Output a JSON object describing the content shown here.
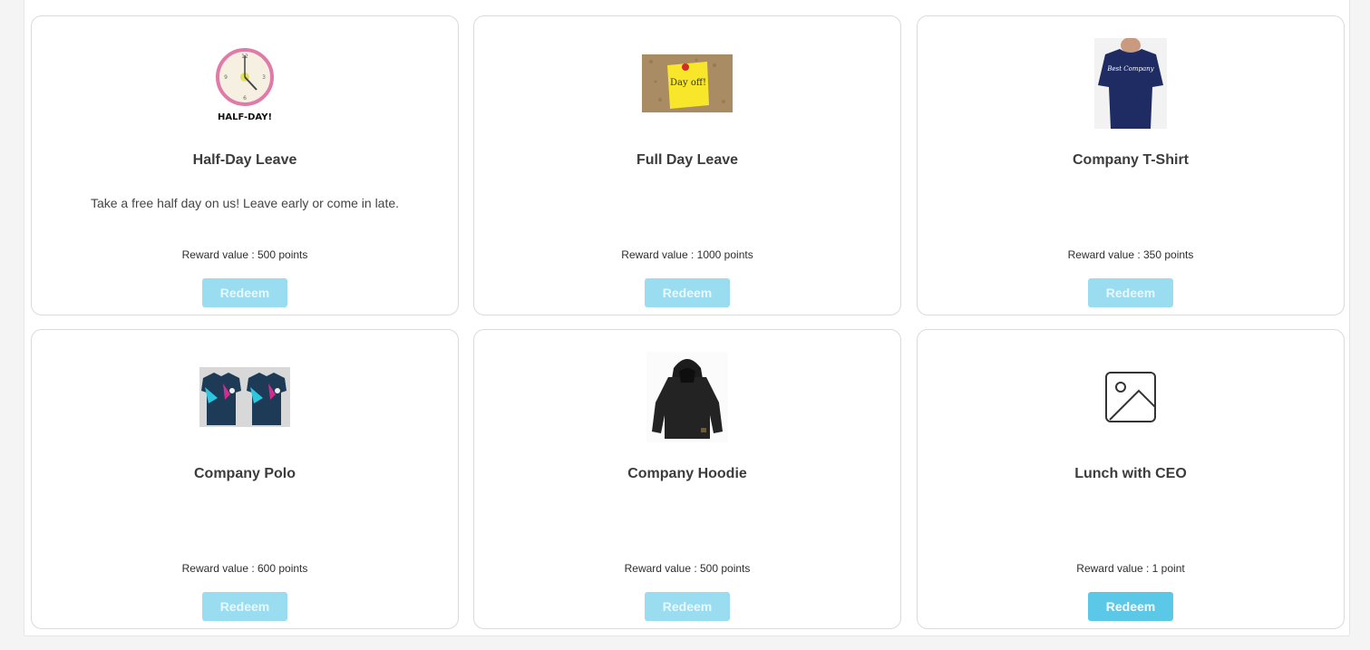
{
  "rewards": [
    {
      "title": "Half-Day Leave",
      "description": "Take a free half day on us! Leave early or come in late.",
      "reward": "Reward value : 500 points",
      "button": "Redeem",
      "image_caption": "HALF-DAY!",
      "image": "clock-illustration"
    },
    {
      "title": "Full Day Leave",
      "description": "",
      "reward": "Reward value : 1000 points",
      "button": "Redeem",
      "image_caption": "Day off!",
      "image": "sticky-note-photo"
    },
    {
      "title": "Company T-Shirt",
      "description": "",
      "reward": "Reward value : 350 points",
      "button": "Redeem",
      "image_caption": "Best Company",
      "image": "tshirt-photo"
    },
    {
      "title": "Company Polo",
      "description": "",
      "reward": "Reward value : 600 points",
      "button": "Redeem",
      "image": "polo-photo"
    },
    {
      "title": "Company Hoodie",
      "description": "",
      "reward": "Reward value : 500 points",
      "button": "Redeem",
      "image": "hoodie-photo"
    },
    {
      "title": "Lunch with CEO",
      "description": "",
      "reward": "Reward value : 1 point",
      "button": "Redeem",
      "image": "image-placeholder-icon"
    }
  ],
  "colors": {
    "button_disabled": "#9adcf0",
    "button_enabled": "#5bc8e8",
    "card_border": "#d9dadb"
  }
}
